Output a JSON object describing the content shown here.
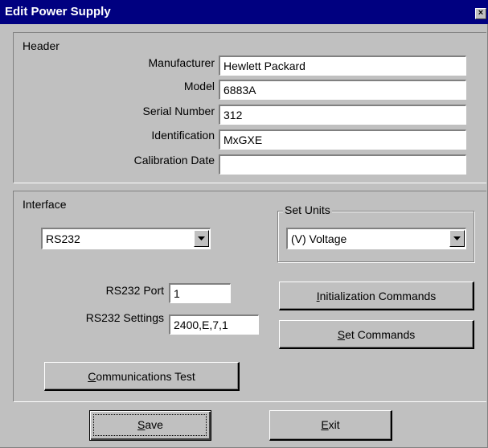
{
  "window": {
    "title": "Edit Power Supply",
    "close_glyph": "×"
  },
  "header": {
    "label": "Header",
    "fields": {
      "manufacturer": {
        "label": "Manufacturer",
        "value": "Hewlett Packard"
      },
      "model": {
        "label": "Model",
        "value": "6883A"
      },
      "serial": {
        "label": "Serial Number",
        "value": "312"
      },
      "identification": {
        "label": "Identification",
        "value": "MxGXE"
      },
      "calibration": {
        "label": "Calibration Date",
        "value": ""
      }
    }
  },
  "interface": {
    "label": "Interface",
    "type_value": "RS232",
    "set_units": {
      "label": "Set Units",
      "value": "(V) Voltage"
    },
    "port": {
      "label": "RS232 Port",
      "value": "1"
    },
    "settings": {
      "label": "RS232 Settings",
      "value": "2400,E,7,1"
    },
    "buttons": {
      "init": {
        "key": "I",
        "rest": "nitialization Commands"
      },
      "set": {
        "key": "S",
        "rest": "et Commands"
      },
      "comm": {
        "key": "C",
        "rest": "ommunications Test"
      }
    }
  },
  "footer": {
    "save": {
      "key": "S",
      "rest": "ave"
    },
    "exit": {
      "key": "E",
      "rest": "xit"
    }
  }
}
